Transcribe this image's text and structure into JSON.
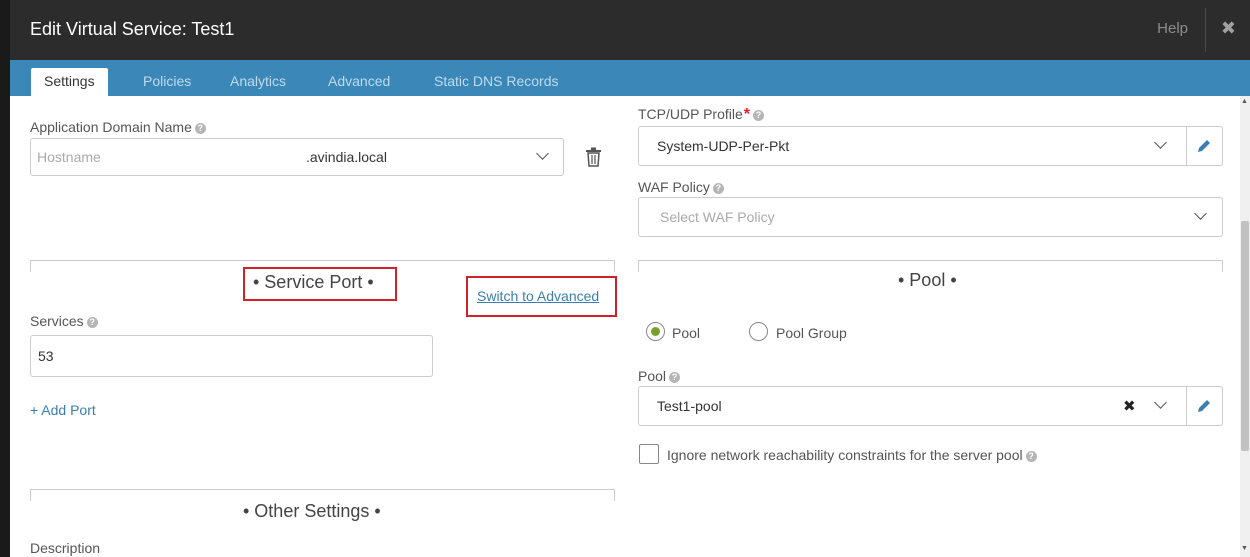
{
  "dialog": {
    "title": "Edit Virtual Service: Test1",
    "help_label": "Help",
    "close_glyph": "✖"
  },
  "tabs": [
    {
      "label": "Settings",
      "active": true
    },
    {
      "label": "Policies",
      "active": false
    },
    {
      "label": "Analytics",
      "active": false
    },
    {
      "label": "Advanced",
      "active": false
    },
    {
      "label": "Static DNS Records",
      "active": false
    }
  ],
  "left": {
    "app_domain": {
      "label": "Application Domain Name",
      "placeholder": "Hostname",
      "suffix": ".avindia.local"
    },
    "service_port": {
      "title": "• Service Port •",
      "switch_link": "Switch to Advanced",
      "services_label": "Services",
      "services_value": "53",
      "add_port": "+ Add Port"
    },
    "other_settings": {
      "title": "• Other Settings •",
      "description_label": "Description"
    }
  },
  "right": {
    "tcp_udp_profile": {
      "label": "TCP/UDP Profile",
      "required_mark": "*",
      "value": "System-UDP-Per-Pkt"
    },
    "waf_policy": {
      "label": "WAF Policy",
      "placeholder": "Select WAF Policy"
    },
    "pool_section": {
      "title": "• Pool •",
      "radio_pool": "Pool",
      "radio_pool_group": "Pool Group",
      "selected_radio": "Pool",
      "pool_label": "Pool",
      "pool_value": "Test1-pool",
      "clear_glyph": "✖",
      "ignore_checkbox_label": "Ignore network reachability constraints for the server pool",
      "ignore_checked": false
    }
  },
  "help_glyph": "?",
  "colors": {
    "title_bar": "#2c2c2c",
    "tab_bar": "#3a87b8",
    "link": "#3a7fb0",
    "highlight_box": "#d0202a",
    "radio_selected": "#7a9e2a",
    "required": "#e02020"
  }
}
